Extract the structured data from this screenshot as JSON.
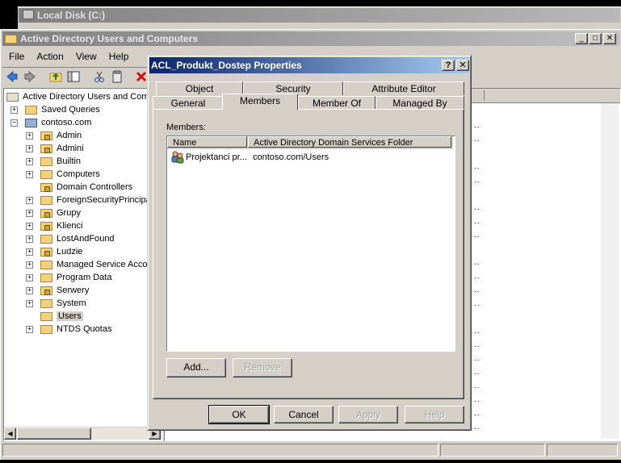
{
  "background_window": {
    "title": "Local Disk (C:)"
  },
  "main_window": {
    "title": "Active Directory Users and Computers",
    "menu": [
      "File",
      "Action",
      "View",
      "Help"
    ],
    "tree": {
      "root": "Active Directory Users and Com",
      "items": [
        {
          "label": "Saved Queries",
          "expander": "+",
          "indent": 0,
          "lock": false
        },
        {
          "label": "contoso.com",
          "expander": "−",
          "indent": 0,
          "lock": false,
          "domain": true
        },
        {
          "label": "Admin",
          "expander": "+",
          "indent": 1,
          "lock": true
        },
        {
          "label": "Admini",
          "expander": "+",
          "indent": 1,
          "lock": true
        },
        {
          "label": "Builtin",
          "expander": "+",
          "indent": 1,
          "lock": false
        },
        {
          "label": "Computers",
          "expander": "+",
          "indent": 1,
          "lock": false
        },
        {
          "label": "Domain Controllers",
          "expander": "",
          "indent": 1,
          "lock": true
        },
        {
          "label": "ForeignSecurityPrincipal",
          "expander": "+",
          "indent": 1,
          "lock": false
        },
        {
          "label": "Grupy",
          "expander": "+",
          "indent": 1,
          "lock": true
        },
        {
          "label": "Klienci",
          "expander": "+",
          "indent": 1,
          "lock": true
        },
        {
          "label": "LostAndFound",
          "expander": "+",
          "indent": 1,
          "lock": false
        },
        {
          "label": "Ludzie",
          "expander": "+",
          "indent": 1,
          "lock": true
        },
        {
          "label": "Managed Service Accou",
          "expander": "+",
          "indent": 1,
          "lock": false
        },
        {
          "label": "Program Data",
          "expander": "+",
          "indent": 1,
          "lock": false
        },
        {
          "label": "Serwery",
          "expander": "+",
          "indent": 1,
          "lock": true
        },
        {
          "label": "System",
          "expander": "+",
          "indent": 1,
          "lock": false
        },
        {
          "label": "Users",
          "expander": "",
          "indent": 1,
          "lock": false,
          "selected": true
        },
        {
          "label": "NTDS Quotas",
          "expander": "+",
          "indent": 1,
          "lock": false
        }
      ]
    }
  },
  "dialog": {
    "title": "ACL_Produkt_Dostep Properties",
    "help_glyph": "?",
    "close_glyph": "✕",
    "tabs_back": [
      "Object",
      "Security",
      "Attribute Editor"
    ],
    "tabs_front": [
      "General",
      "Members",
      "Member Of",
      "Managed By"
    ],
    "active_tab": "Members",
    "members_label": "Members:",
    "columns": [
      "Name",
      "Active Directory Domain Services Folder"
    ],
    "rows": [
      {
        "name": "Projektanci pr...",
        "folder": "contoso.com/Users"
      }
    ],
    "add_button": "Add...",
    "remove_button": "Remove",
    "ok_button": "OK",
    "cancel_button": "Cancel",
    "apply_button": "Apply",
    "help_button": "Help"
  },
  "colors": {
    "dialog_title_gradient_start": "#0a246a",
    "dialog_title_gradient_end": "#a6caf0",
    "inactive_title": "#808080",
    "face": "#d4d0c8"
  }
}
